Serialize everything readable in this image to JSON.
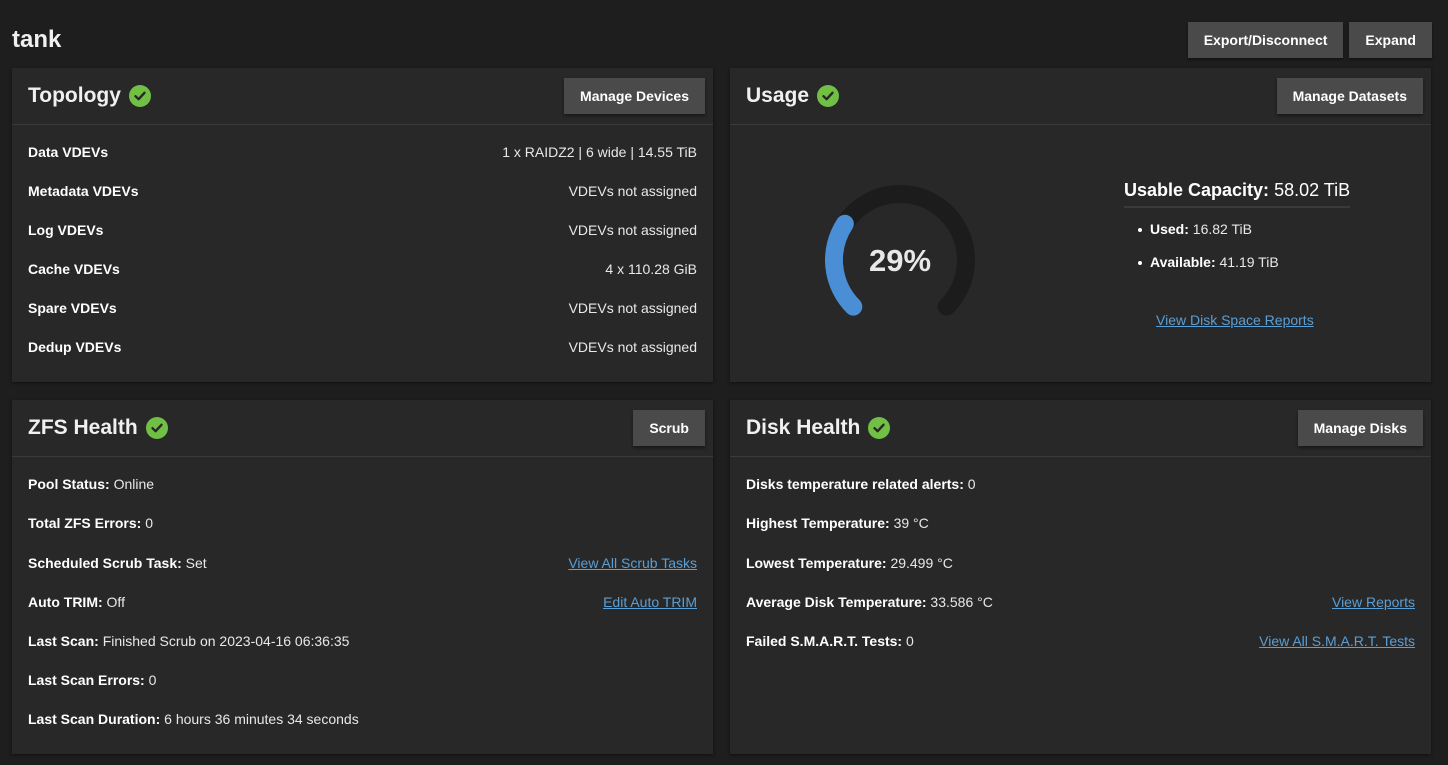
{
  "pool": {
    "name": "tank",
    "export_label": "Export/Disconnect",
    "expand_label": "Expand"
  },
  "topology": {
    "title": "Topology",
    "button": "Manage Devices",
    "rows": [
      {
        "label": "Data VDEVs",
        "value": "1 x RAIDZ2 | 6 wide | 14.55 TiB"
      },
      {
        "label": "Metadata VDEVs",
        "value": "VDEVs not assigned"
      },
      {
        "label": "Log VDEVs",
        "value": "VDEVs not assigned"
      },
      {
        "label": "Cache VDEVs",
        "value": "4 x 110.28 GiB"
      },
      {
        "label": "Spare VDEVs",
        "value": "VDEVs not assigned"
      },
      {
        "label": "Dedup VDEVs",
        "value": "VDEVs not assigned"
      }
    ]
  },
  "usage": {
    "title": "Usage",
    "button": "Manage Datasets",
    "percent": 29,
    "percent_label": "29%",
    "capacity_label": "Usable Capacity:",
    "capacity_value": "58.02 TiB",
    "used_label": "Used:",
    "used_value": "16.82 TiB",
    "available_label": "Available:",
    "available_value": "41.19 TiB",
    "report_link": "View Disk Space Reports",
    "colors": {
      "fill": "#4a8fd6",
      "track": "#1c1c1c"
    }
  },
  "zfs_health": {
    "title": "ZFS Health",
    "button": "Scrub",
    "rows": [
      {
        "label": "Pool Status:",
        "value": "Online"
      },
      {
        "label": "Total ZFS Errors:",
        "value": "0"
      },
      {
        "label": "Scheduled Scrub Task:",
        "value": "Set",
        "link": "View All Scrub Tasks"
      },
      {
        "label": "Auto TRIM:",
        "value": "Off",
        "link": "Edit Auto TRIM"
      },
      {
        "label": "Last Scan:",
        "value": "Finished Scrub on 2023-04-16 06:36:35"
      },
      {
        "label": "Last Scan Errors:",
        "value": "0"
      },
      {
        "label": "Last Scan Duration:",
        "value": "6 hours 36 minutes 34 seconds"
      }
    ]
  },
  "disk_health": {
    "title": "Disk Health",
    "button": "Manage Disks",
    "rows": [
      {
        "label": "Disks temperature related alerts:",
        "value": "0"
      },
      {
        "label": "Highest Temperature:",
        "value": "39 °C"
      },
      {
        "label": "Lowest Temperature:",
        "value": "29.499 °C"
      },
      {
        "label": "Average Disk Temperature:",
        "value": "33.586 °C",
        "link": "View Reports"
      },
      {
        "label": "Failed S.M.A.R.T. Tests:",
        "value": "0",
        "link": "View All S.M.A.R.T. Tests"
      }
    ]
  },
  "colors": {
    "accent_check": "#71bf44",
    "link": "#5a9fd6",
    "card_bg": "#282828",
    "page_bg": "#1e1e1e"
  }
}
